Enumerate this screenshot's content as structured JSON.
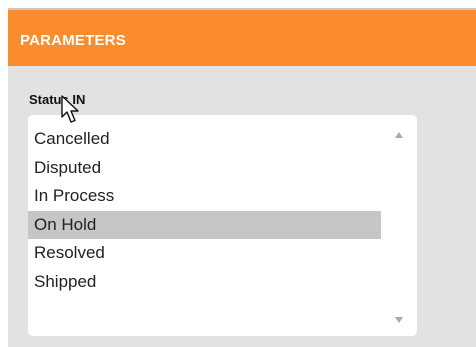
{
  "header": {
    "title": "PARAMETERS",
    "background_color": "#fb8c2d"
  },
  "parameter": {
    "label": "Status IN",
    "options": [
      {
        "label": "Cancelled",
        "selected": false
      },
      {
        "label": "Disputed",
        "selected": false
      },
      {
        "label": "In Process",
        "selected": false
      },
      {
        "label": "On Hold",
        "selected": true
      },
      {
        "label": "Resolved",
        "selected": false
      },
      {
        "label": "Shipped",
        "selected": false
      }
    ],
    "selected_color": "#c6c6c6"
  },
  "icons": {
    "scroll_up": "triangle-up-icon",
    "scroll_down": "triangle-down-icon",
    "cursor": "mouse-pointer-icon"
  }
}
